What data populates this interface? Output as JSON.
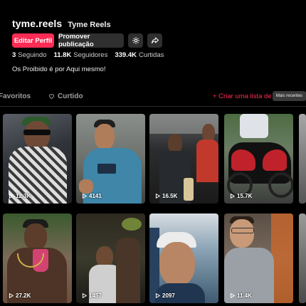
{
  "profile": {
    "username": "tyme.reels",
    "nickname": "Tyme Reels",
    "bio": "Os Proibido é por Aqui mesmo!"
  },
  "actions": {
    "edit_label": "Editar Perfil",
    "promote_label": "Promover publicação",
    "settings_icon": "gear-icon",
    "share_icon": "share-icon"
  },
  "stats": {
    "following": {
      "value": "3",
      "label": "Seguindo"
    },
    "followers": {
      "value": "11.8K",
      "label": "Seguidores"
    },
    "likes": {
      "value": "339.4K",
      "label": "Curtidas"
    }
  },
  "tabs": {
    "favorites": "Favoritos",
    "liked": "Curtido",
    "create_playlist": "+ Criar uma lista de re",
    "tooltip": "Mais recentes"
  },
  "colors": {
    "accent": "#fe2c55"
  },
  "videos": [
    {
      "views": "12.3K"
    },
    {
      "views": "4141"
    },
    {
      "views": "16.5K"
    },
    {
      "views": "15.7K"
    },
    {
      "views": "27.2K"
    },
    {
      "views": "1457"
    },
    {
      "views": "2097"
    },
    {
      "views": "11.4K"
    }
  ]
}
